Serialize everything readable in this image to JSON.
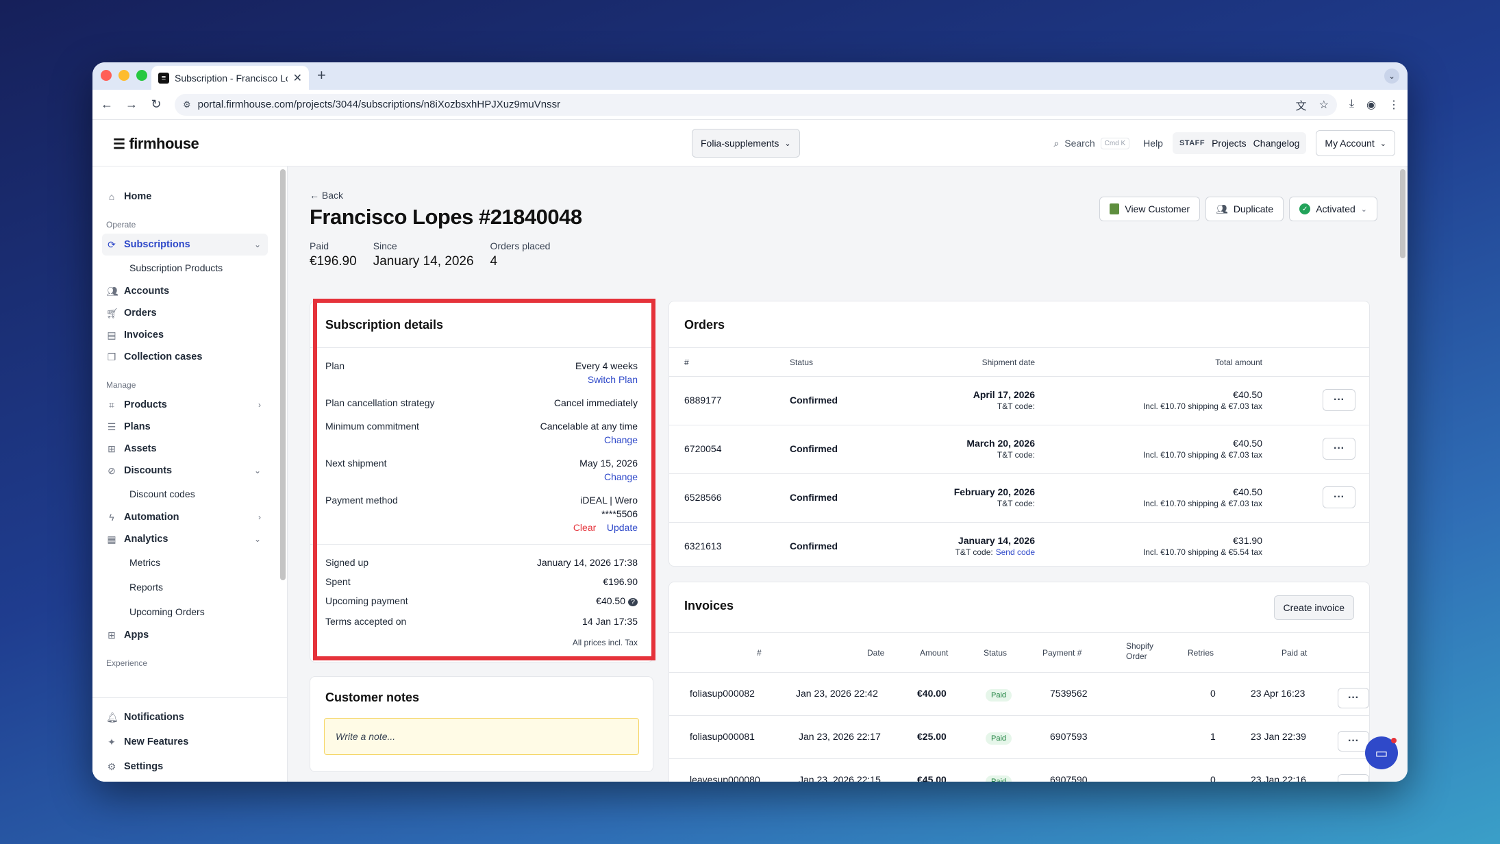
{
  "browser": {
    "tab_title": "Subscription - Francisco Lopes",
    "url": "portal.firmhouse.com/projects/3044/subscriptions/n8iXozbsxhHPJXuz9muVnssr"
  },
  "header": {
    "logo": "firmhouse",
    "project": "Folia-supplements",
    "search_label": "Search",
    "search_kbd": "Cmd K",
    "help": "Help",
    "staff_tag": "STAFF",
    "projects": "Projects",
    "changelog": "Changelog",
    "account": "My Account"
  },
  "sidebar": {
    "home": "Home",
    "section_operate": "Operate",
    "subscriptions": "Subscriptions",
    "subscription_products": "Subscription Products",
    "accounts": "Accounts",
    "orders": "Orders",
    "invoices": "Invoices",
    "collection_cases": "Collection cases",
    "section_manage": "Manage",
    "products": "Products",
    "plans": "Plans",
    "assets": "Assets",
    "discounts": "Discounts",
    "discount_codes": "Discount codes",
    "automation": "Automation",
    "analytics": "Analytics",
    "metrics": "Metrics",
    "reports": "Reports",
    "upcoming_orders": "Upcoming Orders",
    "apps": "Apps",
    "section_experience": "Experience",
    "notifications": "Notifications",
    "new_features": "New Features",
    "settings": "Settings"
  },
  "page": {
    "back": "Back",
    "title": "Francisco Lopes #21840048",
    "stats": [
      {
        "label": "Paid",
        "value": "€196.90"
      },
      {
        "label": "Since",
        "value": "January 14, 2026"
      },
      {
        "label": "Orders placed",
        "value": "4"
      }
    ],
    "actions": {
      "view_customer": "View Customer",
      "duplicate": "Duplicate",
      "activated": "Activated"
    }
  },
  "subscription": {
    "title": "Subscription details",
    "plan_label": "Plan",
    "plan_value": "Every 4 weeks",
    "switch_plan": "Switch Plan",
    "cancellation_label": "Plan cancellation strategy",
    "cancellation_value": "Cancel immediately",
    "commitment_label": "Minimum commitment",
    "commitment_value": "Cancelable at any time",
    "commitment_change": "Change",
    "next_shipment_label": "Next shipment",
    "next_shipment_value": "May 15, 2026",
    "next_shipment_change": "Change",
    "payment_label": "Payment method",
    "payment_value": "iDEAL | Wero",
    "payment_account": "****5506",
    "payment_clear": "Clear",
    "payment_update": "Update",
    "signed_up_label": "Signed up",
    "signed_up_value": "January 14, 2026 17:38",
    "spent_label": "Spent",
    "spent_value": "€196.90",
    "upcoming_label": "Upcoming payment",
    "upcoming_value": "€40.50",
    "terms_label": "Terms accepted on",
    "terms_value": "14 Jan 17:35",
    "tax_note": "All prices incl. Tax"
  },
  "notes": {
    "title": "Customer notes",
    "placeholder": "Write a note..."
  },
  "orders": {
    "title": "Orders",
    "columns": {
      "num": "#",
      "status": "Status",
      "shipment": "Shipment date",
      "total": "Total amount"
    },
    "tt_label": "T&T code:",
    "send_code": "Send code",
    "rows": [
      {
        "num": "6889177",
        "status": "Confirmed",
        "date": "April 17, 2026",
        "total": "€40.50",
        "detail": "Incl. €10.70 shipping & €7.03 tax"
      },
      {
        "num": "6720054",
        "status": "Confirmed",
        "date": "March 20, 2026",
        "total": "€40.50",
        "detail": "Incl. €10.70 shipping & €7.03 tax"
      },
      {
        "num": "6528566",
        "status": "Confirmed",
        "date": "February 20, 2026",
        "total": "€40.50",
        "detail": "Incl. €10.70 shipping & €7.03 tax"
      },
      {
        "num": "6321613",
        "status": "Confirmed",
        "date": "January 14, 2026",
        "total": "€31.90",
        "detail": "Incl. €10.70 shipping & €5.54 tax"
      }
    ]
  },
  "invoices": {
    "title": "Invoices",
    "create": "Create invoice",
    "columns": {
      "num": "#",
      "date": "Date",
      "amount": "Amount",
      "status": "Status",
      "payment": "Payment #",
      "shopify1": "Shopify",
      "shopify2": "Order",
      "retries": "Retries",
      "paid_at": "Paid at"
    },
    "rows": [
      {
        "num": "foliasup000082",
        "date": "Jan 23, 2026 22:42",
        "amount": "€40.00",
        "status": "Paid",
        "payment": "7539562",
        "retries": "0",
        "paid_at": "23 Apr 16:23"
      },
      {
        "num": "foliasup000081",
        "date": "Jan 23, 2026 22:17",
        "amount": "€25.00",
        "status": "Paid",
        "payment": "6907593",
        "retries": "1",
        "paid_at": "23 Jan 22:39"
      },
      {
        "num": "leavesup000080",
        "date": "Jan 23, 2026 22:15",
        "amount": "€45.00",
        "status": "Paid",
        "payment": "6907590",
        "retries": "0",
        "paid_at": "23 Jan 22:16"
      }
    ]
  }
}
